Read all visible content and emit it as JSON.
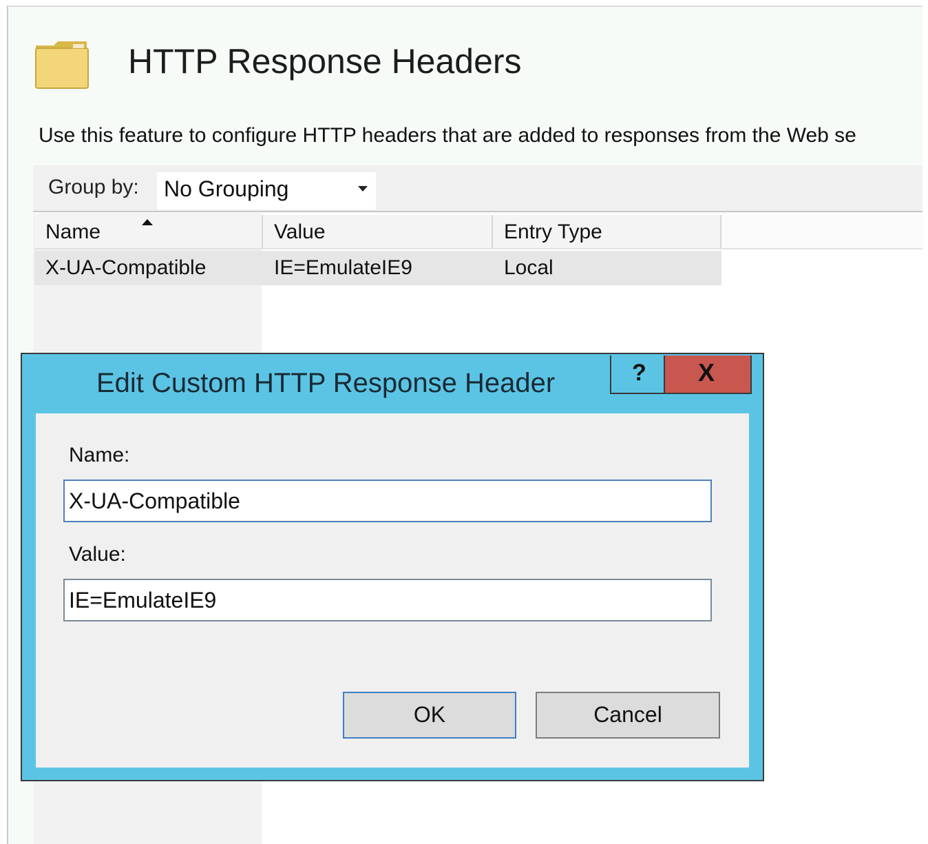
{
  "page": {
    "title": "HTTP Response Headers",
    "description": "Use this feature to configure HTTP headers that are added to responses from the Web se"
  },
  "group_by": {
    "label": "Group by:",
    "value": "No Grouping"
  },
  "table": {
    "columns": [
      "Name",
      "Value",
      "Entry Type"
    ],
    "rows": [
      {
        "name": "X-UA-Compatible",
        "value": "IE=EmulateIE9",
        "entry_type": "Local"
      }
    ]
  },
  "dialog": {
    "title": "Edit Custom HTTP Response Header",
    "help_label": "?",
    "close_label": "X",
    "name_label": "Name:",
    "name_value": "X-UA-Compatible",
    "value_label": "Value:",
    "value_value": "IE=EmulateIE9",
    "ok_label": "OK",
    "cancel_label": "Cancel"
  },
  "icons": {
    "page_icon": "folder-icon"
  },
  "colors": {
    "dialog_frame": "#5bc4e4",
    "close_button": "#c8574f"
  }
}
